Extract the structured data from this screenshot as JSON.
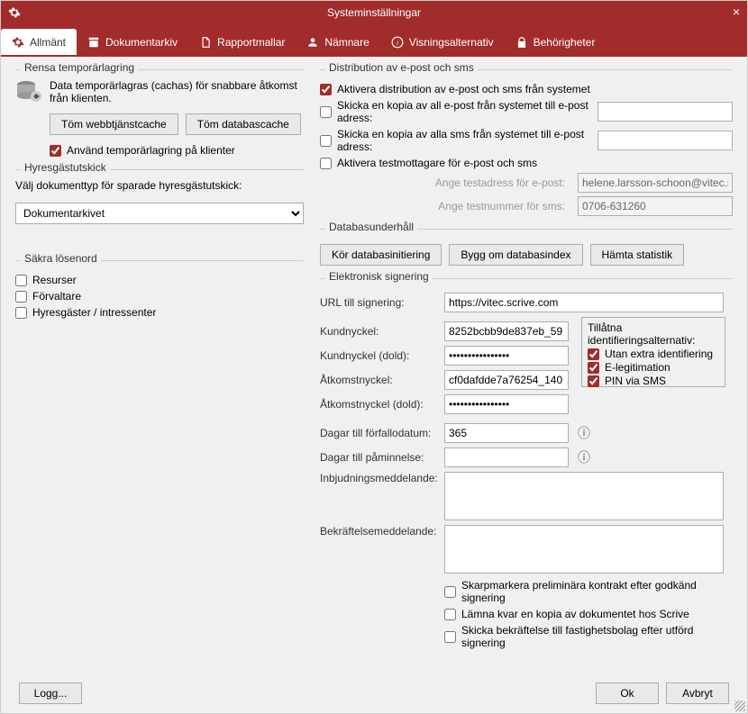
{
  "title": "Systeminställningar",
  "tabs": {
    "allmant": "Allmänt",
    "dokumentarkiv": "Dokumentarkiv",
    "rapportmallar": "Rapportmallar",
    "namnare": "Nämnare",
    "visning": "Visningsalternativ",
    "behorigheter": "Behörigheter"
  },
  "cache": {
    "legend": "Rensa temporärlagring",
    "desc": "Data temporärlagras (cachas) för snabbare åtkomst från klienten.",
    "btn_web": "Töm webbtjänstcache",
    "btn_db": "Töm databascache",
    "use_cache": "Använd temporärlagring på klienter"
  },
  "tenant_send": {
    "legend": "Hyresgästutskick",
    "desc": "Välj dokumenttyp för sparade hyresgästutskick:",
    "selected": "Dokumentarkivet"
  },
  "secure_pw": {
    "legend": "Säkra lösenord",
    "resources": "Resurser",
    "managers": "Förvaltare",
    "tenants": "Hyresgäster / intressenter"
  },
  "dist": {
    "legend": "Distribution av e-post och sms",
    "activate": "Aktivera distribution av e-post och sms från systemet",
    "copy_email": "Skicka en kopia av all e-post från systemet till e-post adress:",
    "copy_sms": "Skicka en kopia av alla sms från systemet till e-post adress:",
    "test_recv": "Aktivera testmottagare för e-post och sms",
    "test_email_label": "Ange testadress för e-post:",
    "test_sms_label": "Ange testnummer för sms:",
    "test_email_value": "helene.larsson-schoon@vitec.se",
    "test_sms_value": "0706-631260"
  },
  "dbm": {
    "legend": "Databasunderhåll",
    "init": "Kör databasinitiering",
    "rebuild": "Bygg om databasindex",
    "stats": "Hämta statistik"
  },
  "esign": {
    "legend": "Elektronisk signering",
    "url_label": "URL till signering:",
    "url_value": "https://vitec.scrive.com",
    "key_label": "Kundnyckel:",
    "key_value": "8252bcbb9de837eb_59",
    "key_hidden_label": "Kundnyckel (dold):",
    "key_hidden_value": "••••••••••••••••",
    "access_label": "Åtkomstnyckel:",
    "access_value": "cf0dafdde7a76254_140",
    "access_hidden_label": "Åtkomstnyckel (dold):",
    "access_hidden_value": "••••••••••••••••",
    "due_label": "Dagar till förfallodatum:",
    "due_value": "365",
    "remind_label": "Dagar till påminnelse:",
    "remind_value": "",
    "invite_label": "Inbjudningsmeddelande:",
    "confirm_label": "Bekräftelsemeddelande:",
    "auth_title": "Tillåtna identifieringsalternativ:",
    "auth_noextra": "Utan extra identifiering",
    "auth_eleg": "E-legitimation",
    "auth_pin": "PIN via SMS",
    "mark_prelim": "Skarpmarkera preliminära kontrakt efter godkänd signering",
    "leave_copy": "Lämna kvar en kopia av dokumentet hos Scrive",
    "send_confirm": "Skicka bekräftelse till fastighetsbolag efter utförd signering"
  },
  "footer": {
    "log": "Logg...",
    "ok": "Ok",
    "cancel": "Avbryt"
  }
}
